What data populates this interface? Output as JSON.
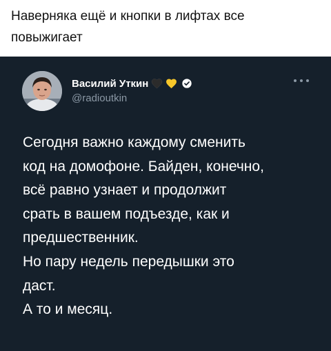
{
  "caption": {
    "lines": [
      "Наверняка ещё и кнопки в лифтах все",
      "повыжигает"
    ]
  },
  "tweet": {
    "author": {
      "name": "Василий Уткин",
      "handle": "@radioutkin"
    },
    "badges": [
      "black-heart-icon",
      "yellow-heart-icon",
      "verified-badge-icon"
    ],
    "colors": {
      "background": "#15202b",
      "text": "#ffffff",
      "muted": "#8b98a5",
      "heart_black": "#2b2b2b",
      "heart_yellow": "#f7c72a"
    },
    "lines": [
      "Сегодня важно каждому сменить",
      "код на домофоне. Байден, конечно,",
      "всё равно узнает и продолжит",
      "срать в вашем подъезде, как и",
      "предшественник.",
      "Но пару недель передышки это",
      "даст.",
      "А то и месяц."
    ]
  }
}
